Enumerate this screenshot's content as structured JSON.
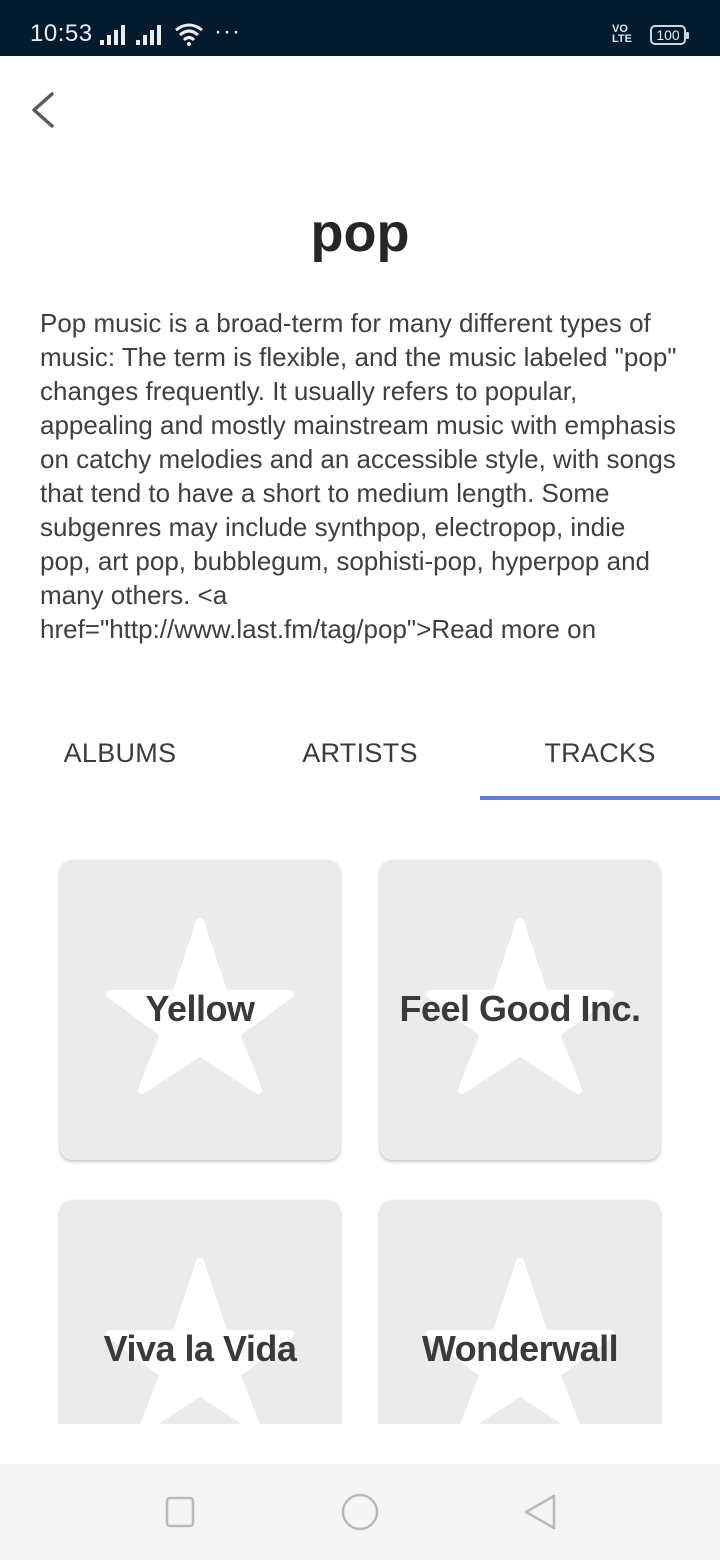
{
  "status_bar": {
    "time": "10:53",
    "dots": "···",
    "volte": [
      "VO",
      "LTE"
    ],
    "battery": "100"
  },
  "header": {
    "back_icon": "chevron-left-icon"
  },
  "tag": {
    "title": "pop",
    "description": "Pop music is a broad-term for many different types of music: The term is flexible, and the music labeled \"pop\" changes frequently. It usually refers to popular, appealing and mostly mainstream music with emphasis on catchy melodies and an accessible style, with songs that tend to have a short to medium length. Some subgenres may include synthpop, electropop, indie pop, art pop, bubblegum, sophisti-pop, hyperpop and many others. <a href=\"http://www.last.fm/tag/pop\">Read more on"
  },
  "tabs": [
    {
      "label": "ALBUMS",
      "active": false
    },
    {
      "label": "ARTISTS",
      "active": false
    },
    {
      "label": "TRACKS",
      "active": true
    }
  ],
  "tracks": [
    {
      "title": "Yellow",
      "icon": "star-icon"
    },
    {
      "title": "Feel Good Inc.",
      "icon": "star-icon"
    },
    {
      "title": "Viva la Vida",
      "icon": "star-icon"
    },
    {
      "title": "Wonderwall",
      "icon": "star-icon"
    }
  ],
  "nav_bar": {
    "recents_icon": "square-icon",
    "home_icon": "circle-icon",
    "back_icon": "triangle-back-icon"
  },
  "colors": {
    "status_bar_bg": "#041a2d",
    "tab_indicator": "#5b7ce6",
    "card_bg": "#ebebeb"
  }
}
